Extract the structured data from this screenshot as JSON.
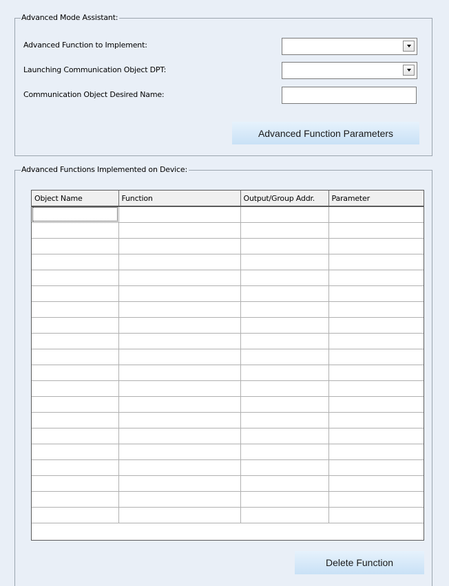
{
  "assistant": {
    "title": "Advanced Mode Assistant:",
    "function_label": "Advanced Function to Implement:",
    "function_value": "",
    "dpt_label": "Launching Communication Object DPT:",
    "dpt_value": "",
    "name_label": "Communication Object Desired Name:",
    "name_value": "",
    "params_button": "Advanced Function Parameters"
  },
  "implemented": {
    "title": "Advanced Functions Implemented on Device:",
    "columns": [
      "Object Name",
      "Function",
      "Output/Group Addr.",
      "Parameter"
    ],
    "row_count": 20,
    "delete_button": "Delete Function"
  }
}
